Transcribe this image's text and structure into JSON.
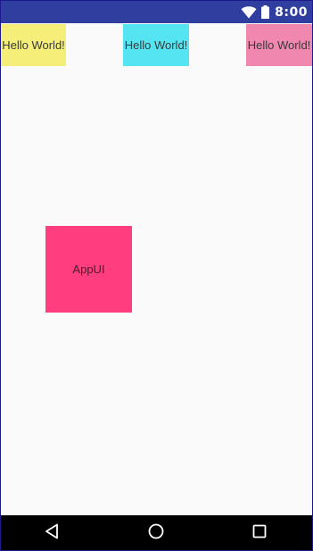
{
  "status_bar": {
    "time": "8:00",
    "icons": [
      "wifi-icon",
      "battery-icon"
    ]
  },
  "content": {
    "hello_boxes": [
      {
        "label": "Hello World!",
        "color": "#f5ee78"
      },
      {
        "label": "Hello World!",
        "color": "#55e4f2"
      },
      {
        "label": "Hello World!",
        "color": "#f087ae"
      }
    ],
    "app_box": {
      "label": "AppUI",
      "color": "#ff3d7f"
    }
  },
  "nav_bar": {
    "icons": [
      "back-icon",
      "home-icon",
      "recents-icon"
    ]
  },
  "colors": {
    "status_bar": "#303f9f",
    "background": "#fafafa",
    "nav_bar": "#000000"
  }
}
